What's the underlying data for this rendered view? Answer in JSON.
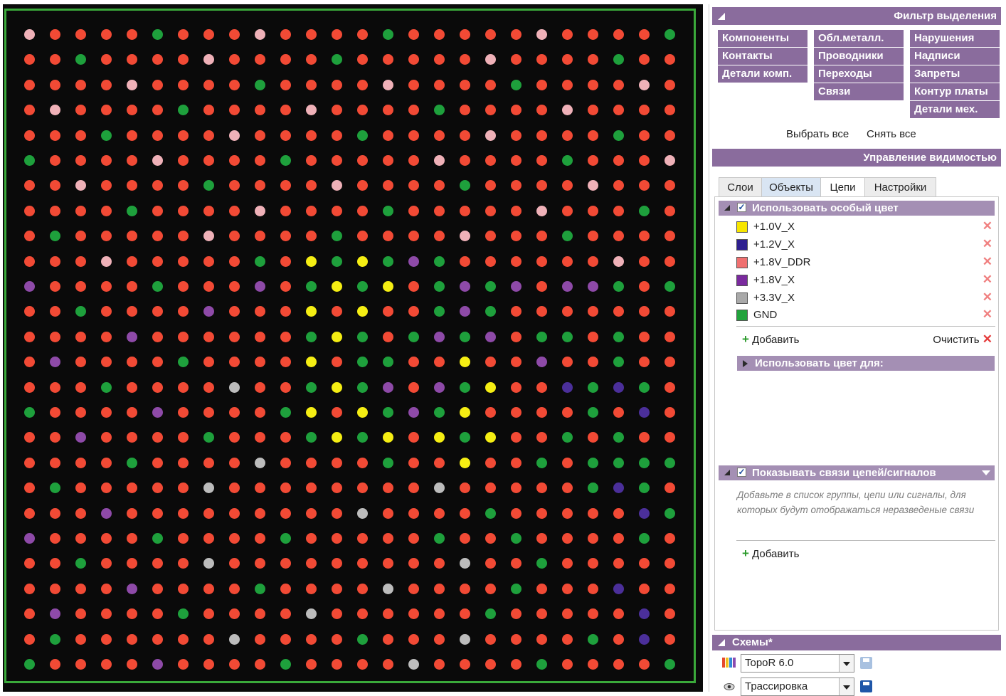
{
  "board": {
    "grid_columns": 26,
    "grid_rows": 26,
    "colors": {
      "R": "#f24a35",
      "G": "#1ea03c",
      "P": "#efb1b8",
      "Y": "#f5ee13",
      "V": "#8e4aa8",
      "S": "#bcbcbc",
      "B": "#4b2f9a"
    },
    "pad_rows": [
      "PRRRRGRRRPRRRRGRRRRRPRRRRG",
      "RRGRRRRPRRRRGRRRRRPRRRRGRR",
      "RRRRPRRRRGRRRRPRRRRGRRRRPR",
      "RPRRRRGRRRRPRRRRGRRRRPRRRR",
      "RRRGRRRRPRRRRGRRRRPRRRRGRR",
      "GRRRRPRRRRGRRRRRPRRRRGRRRP",
      "RRPRRRRGRRRRPRRRRGRRRRPRRR",
      "RRRRGRRRRPRRRRGRRRRRPRRRGR",
      "RGRRRRRPRRRRGRRRRPRRRGRRRR",
      "RRRPRRRRRGRYGYGVGRRRRRRPRR",
      "VRRRRGRRRVRGYGYRGVGVRVVGRG",
      "RRGRRRRVRRRYRYRRGVGRRRRRRR",
      "RRRRVRRRRRRGYGRGVGVRGGRGRR",
      "RVRRRRGRRRRYRGGRRYRRVRRGRR",
      "RRRGRRRRSRRGYGVRVGYRRBGBGR",
      "GRRRRVRRRRGYRYGVGYRRRRGRBR",
      "RRVRRRRGRRRGYGYRYGYRRGRGRR",
      "RRRRGRRRRSRRRRGRRYRRGRGGGG",
      "RGRRRRRSRRRRRRRRSRRRRRGBGR",
      "RRRVRRRRRRRRRSRRRRGRRRRRBG",
      "VRRRRGRRRRGRRRRRGRRGRRRRGR",
      "RRGRRRRSRRRRRRRRRSRRGRRRRR",
      "RRRRVRRRRGRRRRSRRRRGRRRBRR",
      "RVRRRRGRRRRSRRRRRRGRRRRRBR",
      "RGRRRRRRSRRRRGRRRSRRRRGRBR",
      "GRRRRVRRRRGRRRRSRRRRGRRRRG"
    ]
  },
  "selection_filter": {
    "title": "Фильтр выделения",
    "col1": [
      "Компоненты",
      "Контакты",
      "Детали комп."
    ],
    "col2": [
      "Обл.металл.",
      "Проводники",
      "Переходы",
      "Связи"
    ],
    "col3": [
      "Нарушения",
      "Надписи",
      "Запреты",
      "Контур платы",
      "Детали мех."
    ],
    "select_all": "Выбрать все",
    "deselect_all": "Снять все"
  },
  "visibility": {
    "title": "Управление видимостью",
    "tabs": [
      "Слои",
      "Объекты",
      "Цепи",
      "Настройки"
    ],
    "selected_tab": "Цепи",
    "use_special_color": {
      "label": "Использовать особый цвет",
      "checked": true,
      "nets": [
        {
          "name": "+1.0V_X",
          "color": "#f7e600"
        },
        {
          "name": "+1.2V_X",
          "color": "#2e1f8f"
        },
        {
          "name": "+1.8V_DDR",
          "color": "#f07070"
        },
        {
          "name": "+1.8V_X",
          "color": "#7a2a9e"
        },
        {
          "name": "+3.3V_X",
          "color": "#a9a9a9"
        },
        {
          "name": "GND",
          "color": "#22a33c"
        }
      ],
      "add_label": "Добавить",
      "clear_label": "Очистить"
    },
    "use_color_for": "Использовать цвет для:",
    "show_connections": {
      "label": "Показывать связи цепей/сигналов",
      "checked": true,
      "hint": "Добавьте в список группы, цепи или сигналы, для которых будут отображаться неразведеные связи",
      "add_label": "Добавить"
    }
  },
  "schemes": {
    "title": "Схемы*",
    "combo1": "TopoR 6.0",
    "combo2": "Трассировка"
  }
}
